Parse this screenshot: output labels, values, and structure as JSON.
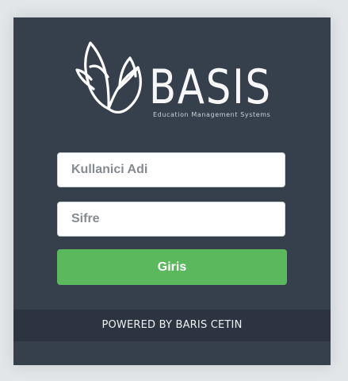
{
  "logo": {
    "icon": "lotus-leaf-icon",
    "name": "BASIS",
    "tagline": "Education Management Systems"
  },
  "form": {
    "username_placeholder": "Kullanici Adi",
    "password_placeholder": "Sifre",
    "submit_label": "Giris"
  },
  "footer": {
    "text": "POWERED BY BARIS CETIN"
  },
  "colors": {
    "page_background": "#e3e6e9",
    "panel_background": "#36404d",
    "footer_background": "#2b3440",
    "button_background": "#5cb85c",
    "button_text": "#ffffff"
  }
}
